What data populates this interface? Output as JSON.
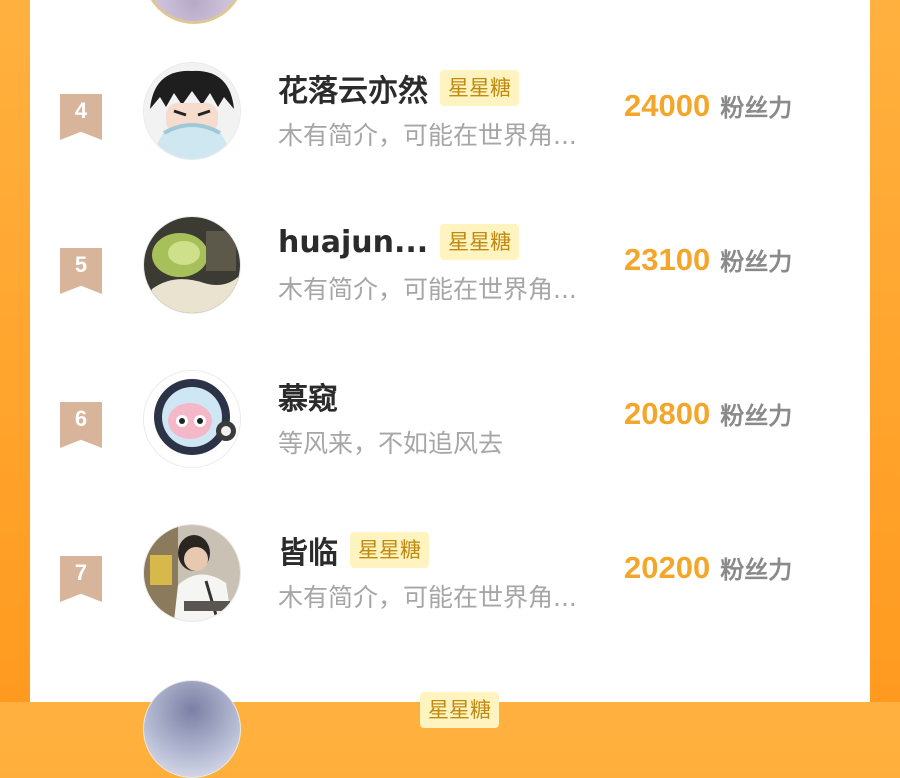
{
  "ranking": {
    "rows": [
      {
        "rank": "4",
        "name": "花落云亦然",
        "badge": "星星糖",
        "bio": "木有简介，可能在世界角...",
        "score": "24000",
        "unit": "粉丝力",
        "avatar": "anime-boy-avatar"
      },
      {
        "rank": "5",
        "name": "huajun...",
        "badge": "星星糖",
        "bio": "木有简介，可能在世界角...",
        "score": "23100",
        "unit": "粉丝力",
        "avatar": "fruit-photo-avatar"
      },
      {
        "rank": "6",
        "name": "慕窥",
        "badge": "",
        "bio": "等风来，不如追风去",
        "score": "20800",
        "unit": "粉丝力",
        "avatar": "astronaut-cartoon-avatar"
      },
      {
        "rank": "7",
        "name": "皆临",
        "badge": "星星糖",
        "bio": "木有简介，可能在世界角...",
        "score": "20200",
        "unit": "粉丝力",
        "avatar": "person-photo-avatar"
      }
    ],
    "partial_next": {
      "badge": "星星糖"
    }
  },
  "colors": {
    "background_orange": "#ff9a1f",
    "score_orange": "#f3a62a",
    "badge_bg": "#fff4bf",
    "badge_text": "#c08a12",
    "rank_ribbon": "#d8b49a"
  }
}
